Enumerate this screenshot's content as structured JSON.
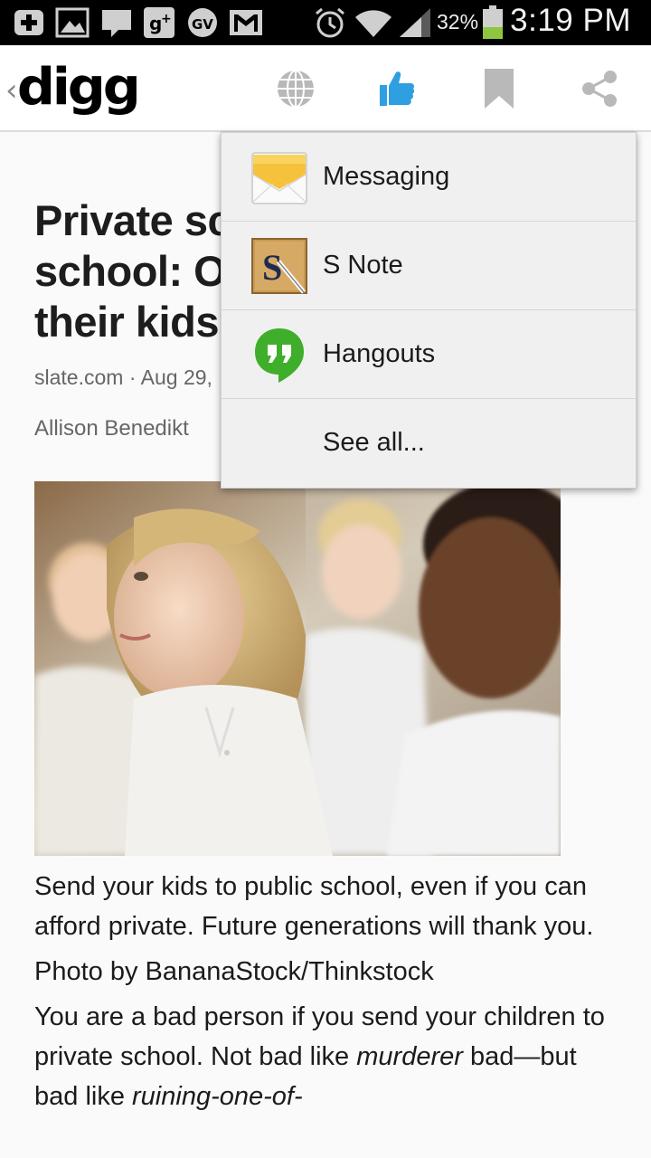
{
  "status_bar": {
    "battery_percent": "32%",
    "time": "3:19 PM"
  },
  "app_bar": {
    "logo": "digg"
  },
  "article": {
    "headline_lines": [
      "Private sc",
      "school: O",
      "their kids"
    ],
    "source": "slate.com",
    "separator": "·",
    "date": "Aug 29,",
    "author": "Allison Benedikt",
    "caption": "Send your kids to public school, even if you can afford private. Future generations will thank you.",
    "photo_credit": "Photo by BananaStock/Thinkstock",
    "body_start": "You are a bad person if you send your children to private school. Not bad like ",
    "body_em1": "murderer",
    "body_mid": " bad—but bad like ",
    "body_em2": "ruining-one-of-"
  },
  "share_menu": {
    "items": [
      {
        "label": "Messaging",
        "icon": "messaging-icon"
      },
      {
        "label": "S Note",
        "icon": "s-note-icon"
      },
      {
        "label": "Hangouts",
        "icon": "hangouts-icon"
      },
      {
        "label": "See all..."
      }
    ]
  },
  "colors": {
    "accent_blue": "#2e9fe0",
    "hangouts_green": "#3fae2a",
    "battery_green": "#8ec63f"
  }
}
